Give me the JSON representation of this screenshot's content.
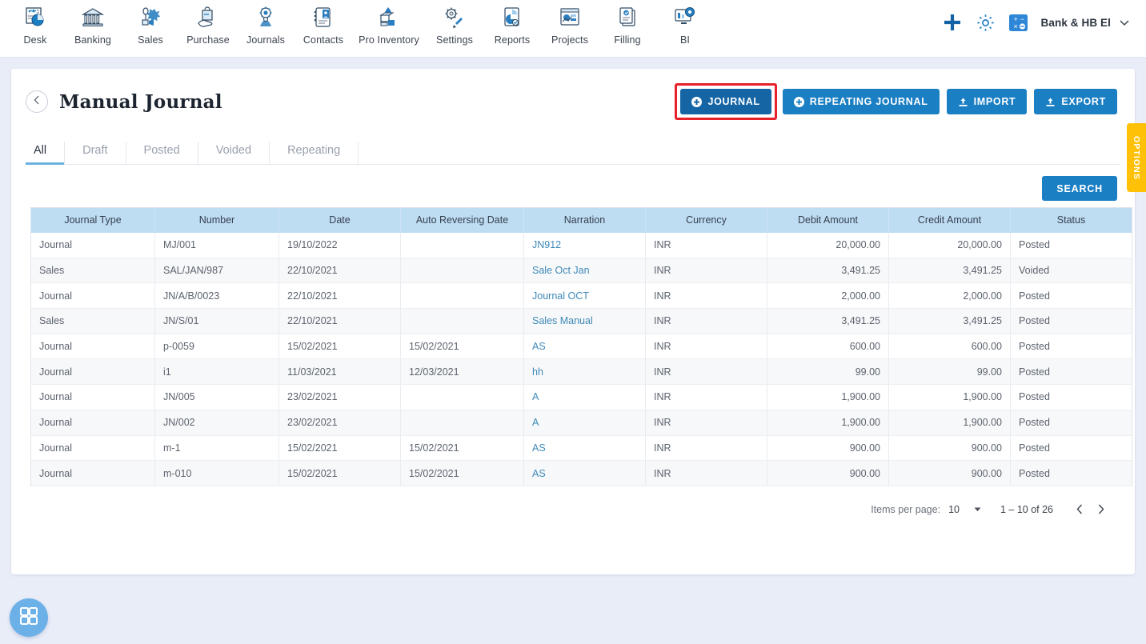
{
  "topnav": {
    "items": [
      {
        "label": "Desk",
        "icon": "dashboard-icon"
      },
      {
        "label": "Banking",
        "icon": "bank-icon"
      },
      {
        "label": "Sales",
        "icon": "sales-icon"
      },
      {
        "label": "Purchase",
        "icon": "purchase-icon"
      },
      {
        "label": "Journals",
        "icon": "journals-icon"
      },
      {
        "label": "Contacts",
        "icon": "contacts-icon"
      },
      {
        "label": "Pro Inventory",
        "icon": "inventory-icon"
      },
      {
        "label": "Settings",
        "icon": "settings-icon"
      },
      {
        "label": "Reports",
        "icon": "reports-icon"
      },
      {
        "label": "Projects",
        "icon": "projects-icon"
      },
      {
        "label": "Filling",
        "icon": "filling-icon"
      },
      {
        "label": "BI",
        "icon": "bi-icon"
      }
    ],
    "add_icon": "plus-icon",
    "settings_icon": "gear-icon",
    "calculator_icon": "calculator-icon",
    "org_name": "Bank & HB El",
    "org_caret_icon": "chevron-down-icon"
  },
  "page": {
    "back_icon": "chevron-left-icon",
    "title": "Manual Journal",
    "actions": {
      "journal": {
        "label": "JOURNAL",
        "icon": "plus-circle-icon",
        "highlighted": true
      },
      "repeating_journal": {
        "label": "REPEATING JOURNAL",
        "icon": "plus-circle-icon"
      },
      "import": {
        "label": "IMPORT",
        "icon": "upload-icon"
      },
      "export": {
        "label": "EXPORT",
        "icon": "upload-icon"
      }
    },
    "tabs": [
      {
        "label": "All",
        "active": true
      },
      {
        "label": "Draft",
        "active": false
      },
      {
        "label": "Posted",
        "active": false
      },
      {
        "label": "Voided",
        "active": false
      },
      {
        "label": "Repeating",
        "active": false
      }
    ],
    "search_label": "SEARCH",
    "options_tab_label": "OPTIONS",
    "fab_icon": "grid-apps-icon"
  },
  "table": {
    "columns": [
      "Journal Type",
      "Number",
      "Date",
      "Auto Reversing Date",
      "Narration",
      "Currency",
      "Debit Amount",
      "Credit Amount",
      "Status"
    ],
    "rows": [
      {
        "type": "Journal",
        "number": "MJ/001",
        "date": "19/10/2022",
        "auto_reversing_date": "",
        "narration": "JN912",
        "currency": "INR",
        "debit": "20,000.00",
        "credit": "20,000.00",
        "status": "Posted"
      },
      {
        "type": "Sales",
        "number": "SAL/JAN/987",
        "date": "22/10/2021",
        "auto_reversing_date": "",
        "narration": "Sale Oct Jan",
        "currency": "INR",
        "debit": "3,491.25",
        "credit": "3,491.25",
        "status": "Voided"
      },
      {
        "type": "Journal",
        "number": "JN/A/B/0023",
        "date": "22/10/2021",
        "auto_reversing_date": "",
        "narration": "Journal OCT",
        "currency": "INR",
        "debit": "2,000.00",
        "credit": "2,000.00",
        "status": "Posted"
      },
      {
        "type": "Sales",
        "number": "JN/S/01",
        "date": "22/10/2021",
        "auto_reversing_date": "",
        "narration": "Sales Manual",
        "currency": "INR",
        "debit": "3,491.25",
        "credit": "3,491.25",
        "status": "Posted"
      },
      {
        "type": "Journal",
        "number": "p-0059",
        "date": "15/02/2021",
        "auto_reversing_date": "15/02/2021",
        "narration": "AS",
        "currency": "INR",
        "debit": "600.00",
        "credit": "600.00",
        "status": "Posted"
      },
      {
        "type": "Journal",
        "number": "i1",
        "date": "11/03/2021",
        "auto_reversing_date": "12/03/2021",
        "narration": "hh",
        "currency": "INR",
        "debit": "99.00",
        "credit": "99.00",
        "status": "Posted"
      },
      {
        "type": "Journal",
        "number": "JN/005",
        "date": "23/02/2021",
        "auto_reversing_date": "",
        "narration": "A",
        "currency": "INR",
        "debit": "1,900.00",
        "credit": "1,900.00",
        "status": "Posted"
      },
      {
        "type": "Journal",
        "number": "JN/002",
        "date": "23/02/2021",
        "auto_reversing_date": "",
        "narration": "A",
        "currency": "INR",
        "debit": "1,900.00",
        "credit": "1,900.00",
        "status": "Posted"
      },
      {
        "type": "Journal",
        "number": "m-1",
        "date": "15/02/2021",
        "auto_reversing_date": "15/02/2021",
        "narration": "AS",
        "currency": "INR",
        "debit": "900.00",
        "credit": "900.00",
        "status": "Posted"
      },
      {
        "type": "Journal",
        "number": "m-010",
        "date": "15/02/2021",
        "auto_reversing_date": "15/02/2021",
        "narration": "AS",
        "currency": "INR",
        "debit": "900.00",
        "credit": "900.00",
        "status": "Posted"
      }
    ]
  },
  "paginator": {
    "items_per_page_label": "Items per page:",
    "items_per_page_value": "10",
    "dropdown_icon": "caret-down-icon",
    "range_label": "1 – 10 of 26",
    "prev_icon": "chevron-left-icon",
    "next_icon": "chevron-right-icon"
  },
  "colors": {
    "accent_blue": "#1b7fc4",
    "accent_blue_dark": "#1565a5",
    "table_header_blue": "#bedcf2",
    "link_blue": "#3e89b8",
    "highlight_red": "#e8202a",
    "options_yellow": "#ffc107",
    "page_bg": "#e9edf8"
  }
}
